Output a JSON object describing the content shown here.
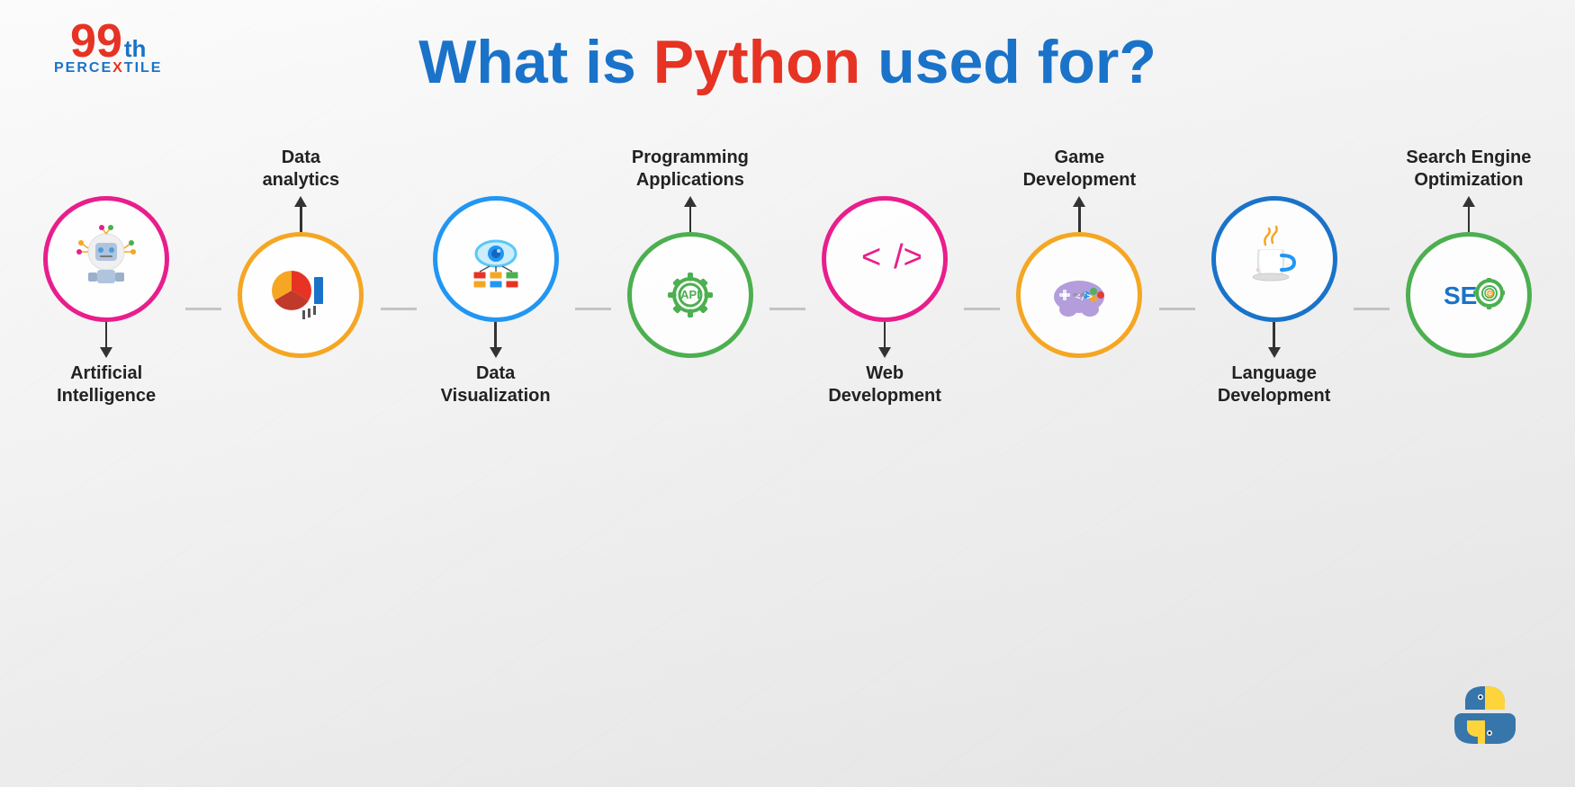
{
  "title": {
    "part1": "What is ",
    "part2": "Python",
    "part3": " used for?",
    "full": "What is Python used for?"
  },
  "logo": {
    "number": "99",
    "suffix": "th",
    "brand": "PERCEXTILE"
  },
  "icons": [
    {
      "id": "ai",
      "label_top": "",
      "label_bottom": "Artificial\nIntelligence",
      "arrow": "down",
      "border_color": "#e91e8c"
    },
    {
      "id": "data-analytics",
      "label_top": "Data\nanalytics",
      "label_bottom": "",
      "arrow": "up",
      "border_color": "#f5a623"
    },
    {
      "id": "data-viz",
      "label_top": "",
      "label_bottom": "Data\nVisualization",
      "arrow": "down",
      "border_color": "#2196f3"
    },
    {
      "id": "programming-apps",
      "label_top": "Programming\nApplications",
      "label_bottom": "",
      "arrow": "up",
      "border_color": "#4caf50"
    },
    {
      "id": "web-dev",
      "label_top": "",
      "label_bottom": "Web\nDevelopment",
      "arrow": "down",
      "border_color": "#e91e8c"
    },
    {
      "id": "game-dev",
      "label_top": "Game\nDevelopment",
      "label_bottom": "",
      "arrow": "up",
      "border_color": "#f5a623"
    },
    {
      "id": "language-dev",
      "label_top": "",
      "label_bottom": "Language\nDevelopment",
      "arrow": "down",
      "border_color": "#1a73c9"
    },
    {
      "id": "seo",
      "label_top": "Search Engine\nOptimization",
      "label_bottom": "",
      "arrow": "up",
      "border_color": "#4caf50"
    }
  ],
  "colors": {
    "title_blue": "#1a73c9",
    "title_red": "#e63323",
    "dark": "#222222"
  }
}
